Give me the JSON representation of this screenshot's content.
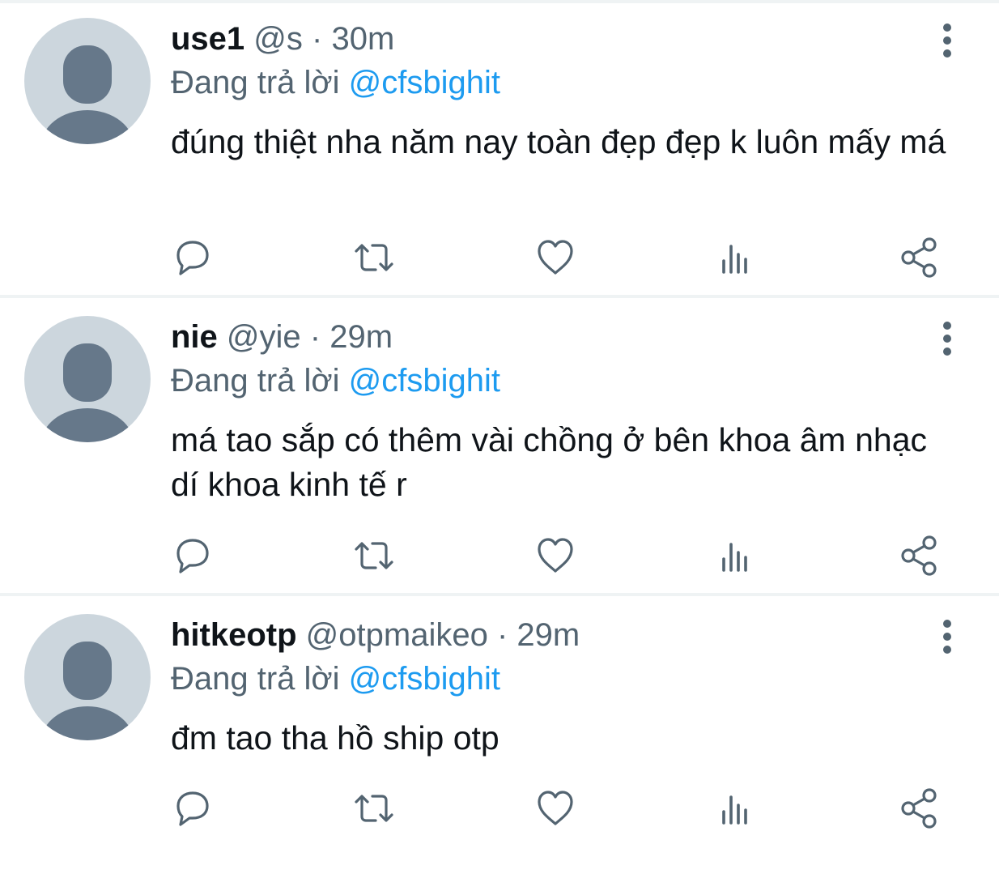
{
  "tweets": [
    {
      "name": "use1",
      "handle": "@s",
      "separator": "·",
      "time": "30m",
      "reply_prefix": "Đang trả lời",
      "reply_to": "@cfsbighit",
      "text": "đúng thiệt nha năm nay toàn đẹp đẹp k luôn mấy má"
    },
    {
      "name": "nie",
      "handle": "@yie",
      "separator": "·",
      "time": "29m",
      "reply_prefix": "Đang trả lời",
      "reply_to": "@cfsbighit",
      "text": "má tao sắp có thêm vài chồng ở bên khoa âm nhạc dí khoa kinh tế r"
    },
    {
      "name": "hitkeotp",
      "handle": "@otpmaikeo",
      "separator": "·",
      "time": "29m",
      "reply_prefix": "Đang trả lời",
      "reply_to": "@cfsbighit",
      "text": "đm tao tha hồ ship otp"
    }
  ],
  "icons": {
    "avatar": "default-avatar-icon",
    "more": "more-vertical-icon",
    "reply": "reply-icon",
    "retweet": "retweet-icon",
    "like": "heart-icon",
    "stats": "stats-icon",
    "share": "share-icon"
  },
  "colors": {
    "background": "#ffffff",
    "text": "#0f1419",
    "secondary": "#536471",
    "accent": "#1d9bf0",
    "avatar_bg": "#ccd6dd",
    "avatar_fg": "#66788a",
    "divider": "#eff3f4"
  }
}
